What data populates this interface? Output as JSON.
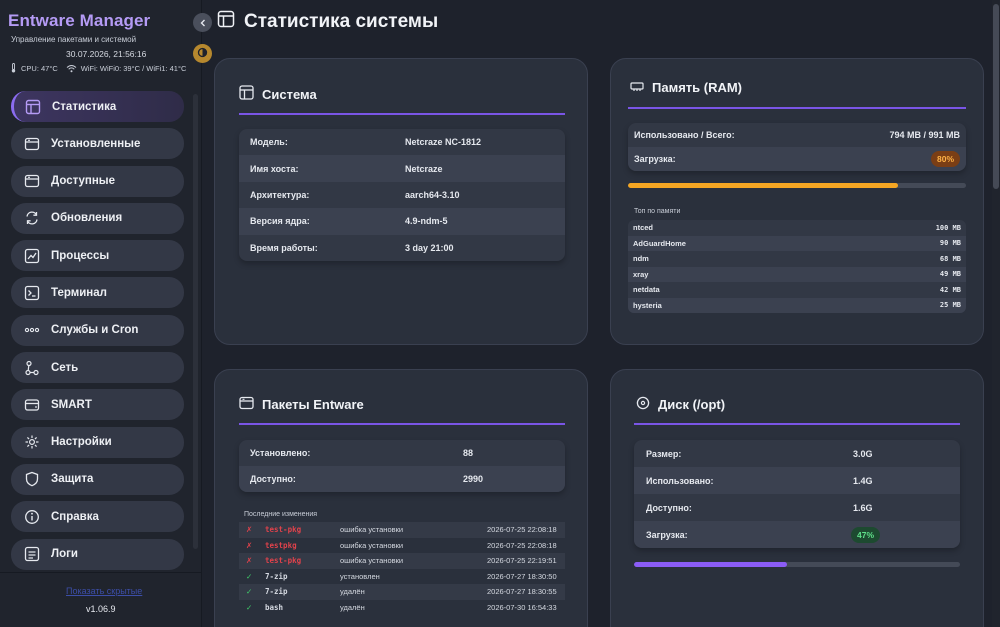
{
  "sidebar": {
    "brand": "Entware Manager",
    "subtitle": "Управление пакетами и системой",
    "datetime": "30.07.2026, 21:56:16",
    "cpu": "CPU: 47°C",
    "wifi": "WiFi: WiFi0: 39°C / WiFi1: 41°C",
    "items": [
      {
        "label": "Статистика",
        "icon": "layout-icon",
        "active": true
      },
      {
        "label": "Установленные",
        "icon": "package-icon"
      },
      {
        "label": "Доступные",
        "icon": "package-icon"
      },
      {
        "label": "Обновления",
        "icon": "refresh-icon"
      },
      {
        "label": "Процессы",
        "icon": "chart-line-icon"
      },
      {
        "label": "Терминал",
        "icon": "terminal-icon"
      },
      {
        "label": "Службы и Cron",
        "icon": "dots-icon"
      },
      {
        "label": "Сеть",
        "icon": "network-icon"
      },
      {
        "label": "SMART",
        "icon": "drive-icon"
      },
      {
        "label": "Настройки",
        "icon": "gear-icon"
      },
      {
        "label": "Защита",
        "icon": "shield-icon"
      },
      {
        "label": "Справка",
        "icon": "info-icon"
      },
      {
        "label": "Логи",
        "icon": "log-icon"
      }
    ],
    "footer_link": "Показать скрытые",
    "version": "v1.06.9"
  },
  "page": {
    "title": "Статистика системы"
  },
  "system": {
    "title": "Система",
    "rows": [
      {
        "k": "Модель:",
        "v": "Netcraze NC-1812"
      },
      {
        "k": "Имя хоста:",
        "v": "Netcraze"
      },
      {
        "k": "Архитектура:",
        "v": "aarch64-3.10"
      },
      {
        "k": "Версия ядра:",
        "v": "4.9-ndm-5"
      },
      {
        "k": "Время работы:",
        "v": "3 day 21:00"
      }
    ]
  },
  "memory": {
    "title": "Память (RAM)",
    "used_label": "Использовано / Всего:",
    "used_value": "794 MB / 991 MB",
    "load_label": "Загрузка:",
    "load_value": "80%",
    "load_fraction": 0.8,
    "top_caption": "Топ по памяти",
    "top": [
      {
        "name": "ntced",
        "mem": "100 MB"
      },
      {
        "name": "AdGuardHome",
        "mem": "90 MB"
      },
      {
        "name": "ndm",
        "mem": "68 MB"
      },
      {
        "name": "xray",
        "mem": "49 MB"
      },
      {
        "name": "netdata",
        "mem": "42 MB"
      },
      {
        "name": "hysteria",
        "mem": "25 MB"
      }
    ],
    "bar_color": "#f5a623"
  },
  "packages": {
    "title": "Пакеты Entware",
    "installed_label": "Установлено:",
    "installed_value": "88",
    "available_label": "Доступно:",
    "available_value": "2990",
    "changes_caption": "Последние изменения",
    "changes": [
      {
        "status": "error",
        "mark": "✗",
        "pkg": "test-pkg",
        "action": "ошибка установки",
        "date": "2026-07-25 22:08:18"
      },
      {
        "status": "error",
        "mark": "✗",
        "pkg": "testpkg",
        "action": "ошибка установки",
        "date": "2026-07-25 22:08:18"
      },
      {
        "status": "error",
        "mark": "✗",
        "pkg": "test-pkg",
        "action": "ошибка установки",
        "date": "2026-07-25 22:19:51"
      },
      {
        "status": "ok",
        "mark": "✓",
        "pkg": "7-zip",
        "action": "установлен",
        "date": "2026-07-27 18:30:50"
      },
      {
        "status": "ok",
        "mark": "✓",
        "pkg": "7-zip",
        "action": "удалён",
        "date": "2026-07-27 18:30:55"
      },
      {
        "status": "ok",
        "mark": "✓",
        "pkg": "bash",
        "action": "удалён",
        "date": "2026-07-30 16:54:33"
      }
    ]
  },
  "disk": {
    "title": "Диск (/opt)",
    "rows": [
      {
        "k": "Размер:",
        "v": "3.0G"
      },
      {
        "k": "Использовано:",
        "v": "1.4G"
      },
      {
        "k": "Доступно:",
        "v": "1.6G"
      }
    ],
    "load_label": "Загрузка:",
    "load_value": "47%",
    "load_fraction": 0.47,
    "bar_color": "#8b5cf6"
  },
  "colors": {
    "accent": "#8b6cf0",
    "warn": "#f5a623",
    "ok": "#3fcf6a",
    "error": "#e0424b"
  }
}
